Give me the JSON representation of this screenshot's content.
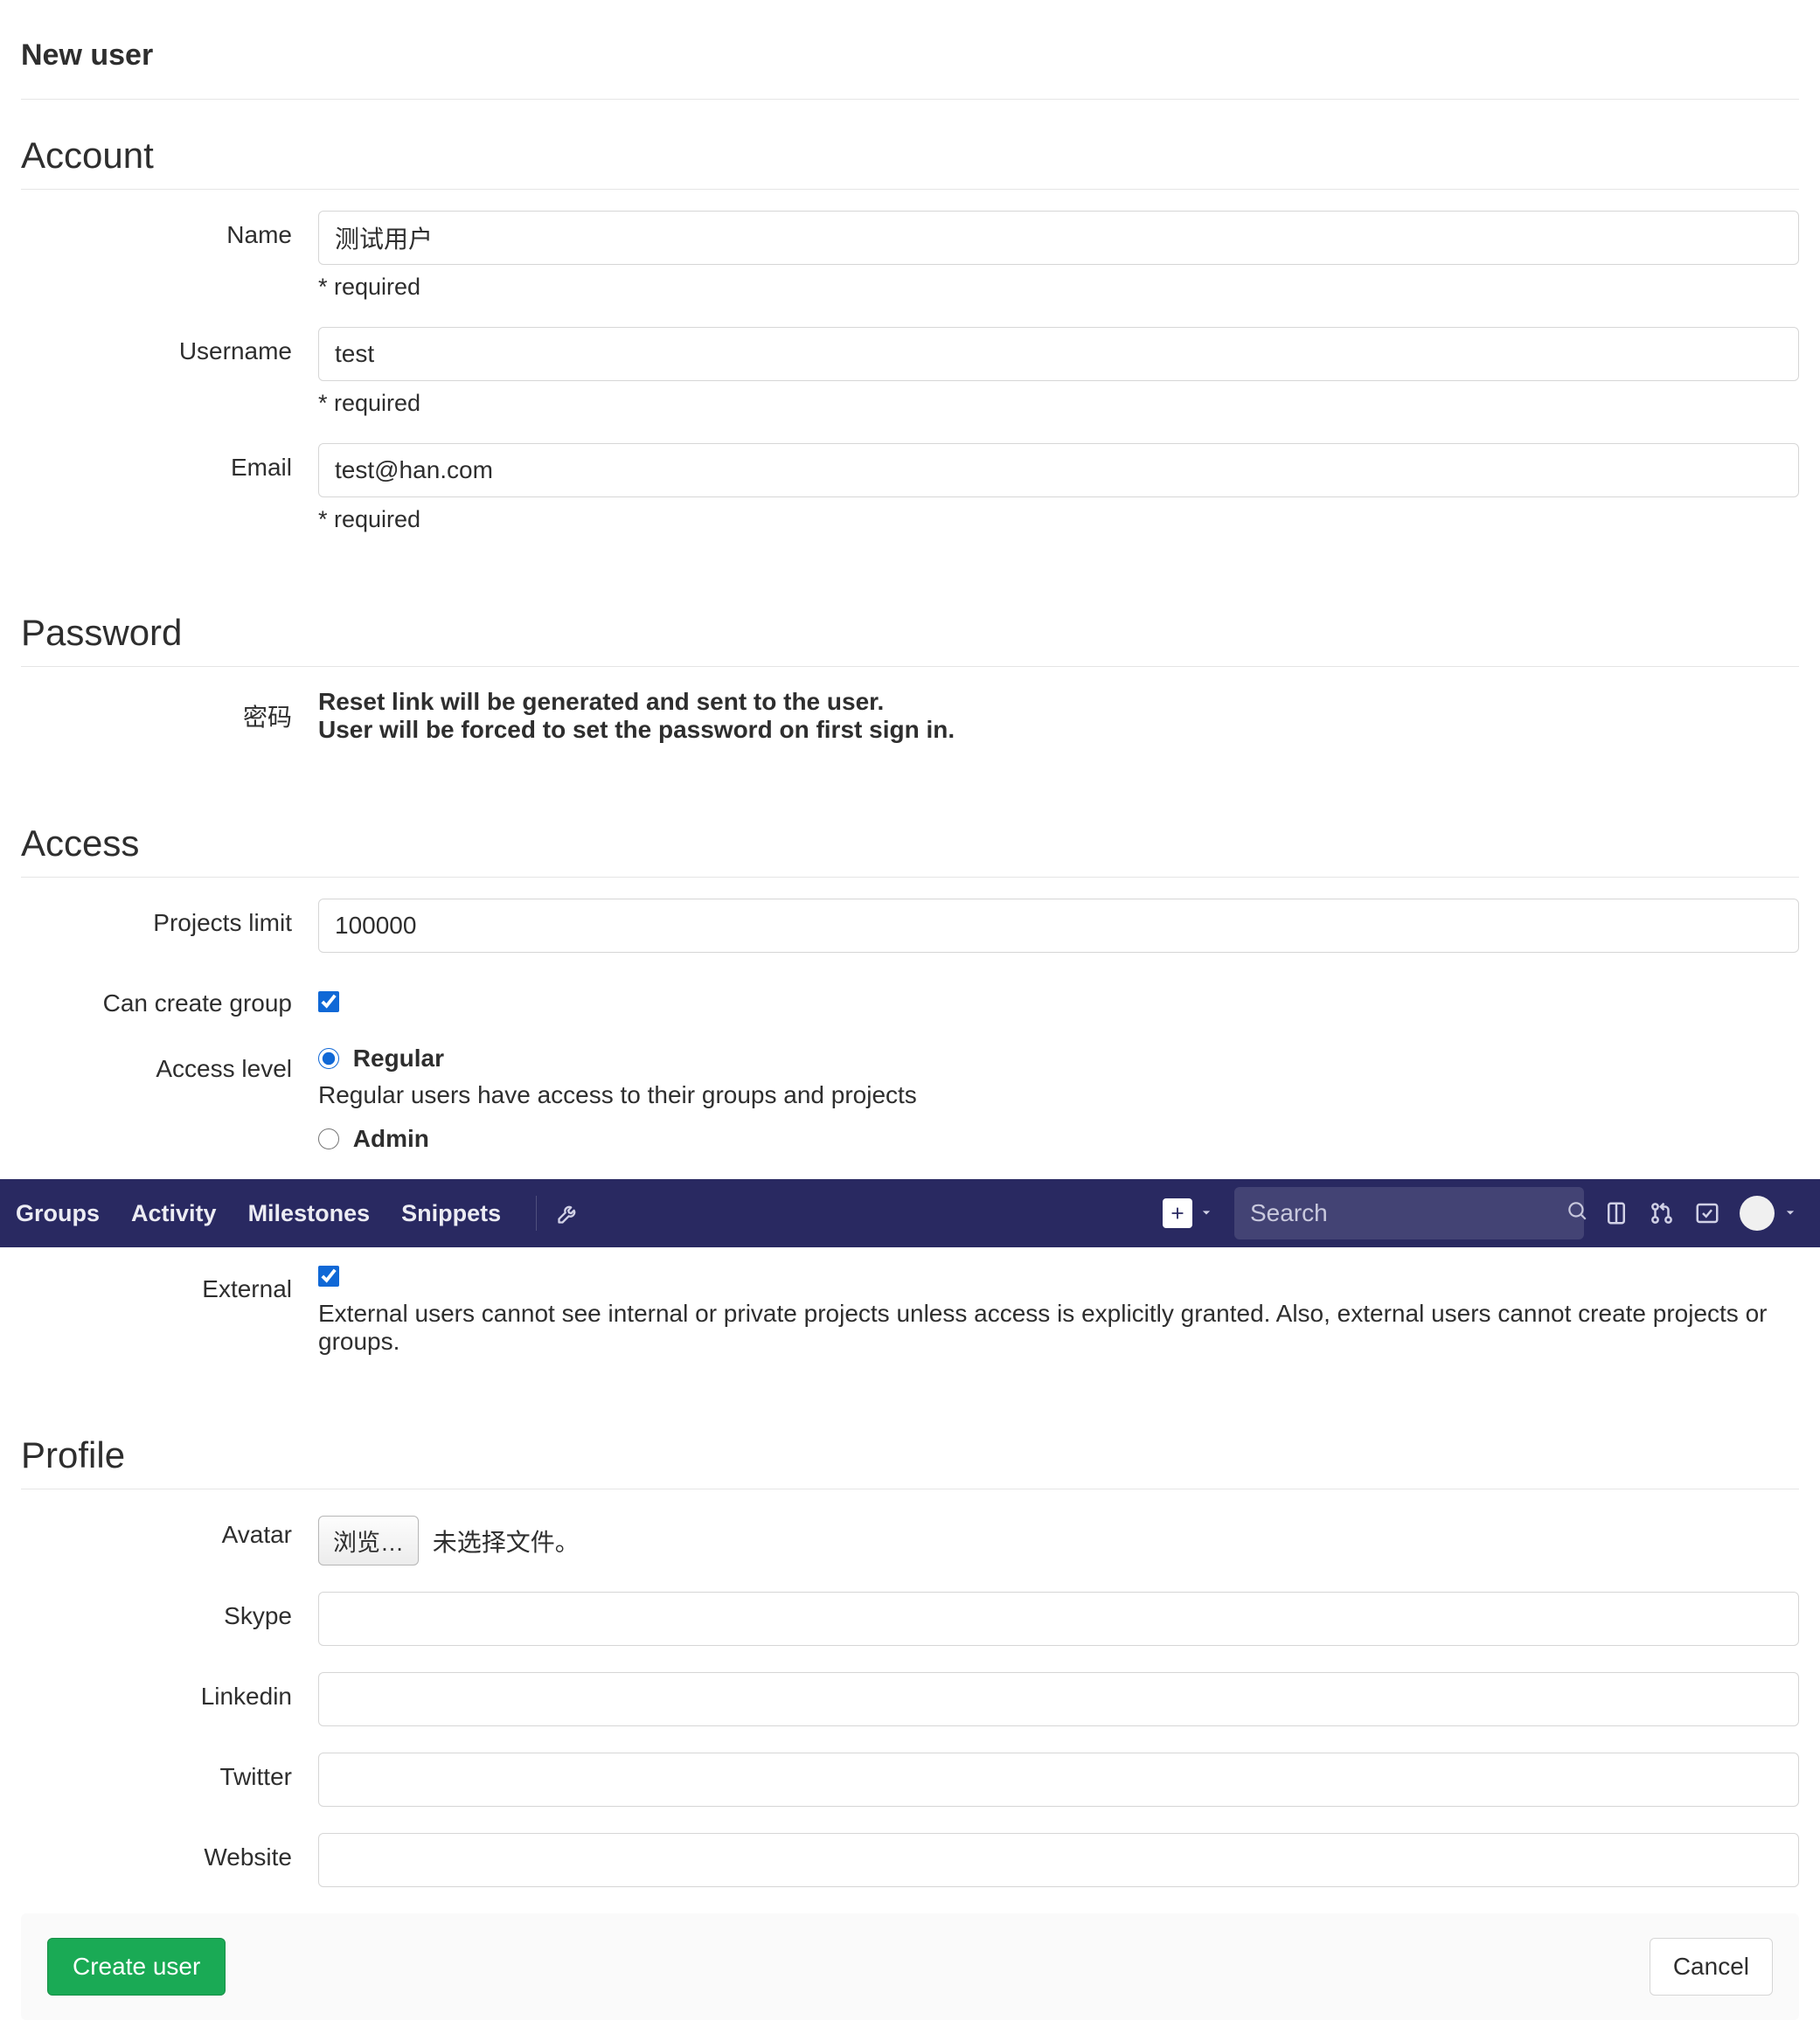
{
  "page_title": "New user",
  "account": {
    "heading": "Account",
    "name_label": "Name",
    "name_value": "测试用户",
    "name_required": "* required",
    "username_label": "Username",
    "username_value": "test",
    "username_required": "* required",
    "email_label": "Email",
    "email_value": "test@han.com",
    "email_required": "* required"
  },
  "password": {
    "heading": "Password",
    "label": "密码",
    "line1": "Reset link will be generated and sent to the user.",
    "line2": "User will be forced to set the password on first sign in."
  },
  "access": {
    "heading": "Access",
    "projects_limit_label": "Projects limit",
    "projects_limit_value": "100000",
    "can_create_group_label": "Can create group",
    "can_create_group_checked": true,
    "access_level_label": "Access level",
    "regular_label": "Regular",
    "regular_desc": "Regular users have access to their groups and projects",
    "admin_label": "Admin",
    "external_label": "External",
    "external_checked": true,
    "external_desc": "External users cannot see internal or private projects unless access is explicitly granted. Also, external users cannot create projects or groups."
  },
  "navbar": {
    "items": [
      "Groups",
      "Activity",
      "Milestones",
      "Snippets"
    ],
    "search_placeholder": "Search"
  },
  "profile": {
    "heading": "Profile",
    "avatar_label": "Avatar",
    "file_button": "浏览…",
    "file_status": "未选择文件。",
    "skype_label": "Skype",
    "skype_value": "",
    "linkedin_label": "Linkedin",
    "linkedin_value": "",
    "twitter_label": "Twitter",
    "twitter_value": "",
    "website_label": "Website",
    "website_value": ""
  },
  "footer": {
    "create_label": "Create user",
    "cancel_label": "Cancel"
  }
}
